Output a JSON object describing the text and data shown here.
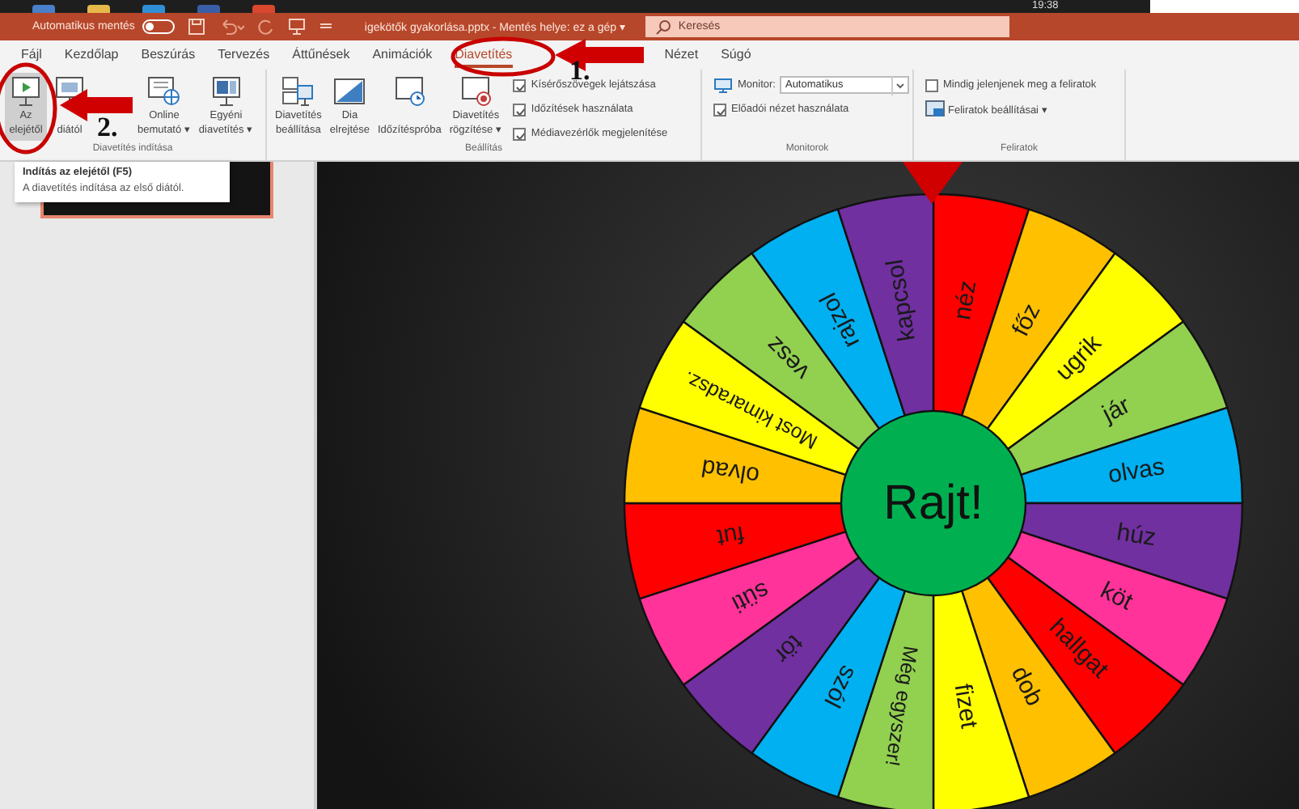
{
  "taskbar": {
    "clock": "19:38"
  },
  "title_bar": {
    "autosave_label": "Automatikus mentés",
    "autosave_on": false,
    "document": "igekötők gyakorlása.pptx  -  Mentés helye: ez a gép ▾",
    "search_placeholder": "Keresés"
  },
  "tabs": [
    {
      "label": "Fájl",
      "selected": false
    },
    {
      "label": "Kezdőlap",
      "selected": false
    },
    {
      "label": "Beszúrás",
      "selected": false
    },
    {
      "label": "Tervezés",
      "selected": false
    },
    {
      "label": "Áttűnések",
      "selected": false
    },
    {
      "label": "Animációk",
      "selected": false
    },
    {
      "label": "Diavetítés",
      "selected": true
    },
    {
      "label": "Nézet",
      "selected": false
    },
    {
      "label": "Súgó",
      "selected": false
    }
  ],
  "ribbon_groups": [
    {
      "title": "Diavetítés indítása",
      "items": [
        {
          "kind": "large",
          "lines": [
            "Az",
            "elejétől"
          ],
          "highlighted": true
        },
        {
          "kind": "large",
          "lines": [
            "diától"
          ],
          "highlighted": false
        },
        {
          "kind": "large",
          "lines": [
            "Online",
            "bemutató ▾"
          ],
          "highlighted": false
        },
        {
          "kind": "large",
          "lines": [
            "Egyéni",
            "diavetítés ▾"
          ],
          "highlighted": false
        }
      ]
    },
    {
      "title": "Beállítás",
      "items": [
        {
          "kind": "large",
          "lines": [
            "Diavetítés",
            "beállítása"
          ],
          "highlighted": false
        },
        {
          "kind": "large",
          "lines": [
            "Dia",
            "elrejtése"
          ],
          "highlighted": false
        },
        {
          "kind": "large",
          "lines": [
            "Időzítéspróba"
          ],
          "highlighted": false
        },
        {
          "kind": "large",
          "lines": [
            "Diavetítés",
            "rögzítése ▾"
          ],
          "highlighted": false
        },
        {
          "kind": "checkbox",
          "label": "Kísérőszövegek lejátszása",
          "checked": true
        },
        {
          "kind": "checkbox",
          "label": "Időzítések használata",
          "checked": true
        },
        {
          "kind": "checkbox",
          "label": "Médiavezérlők megjelenítése",
          "checked": true
        }
      ]
    },
    {
      "title": "Monitorok",
      "items": [
        {
          "kind": "dropdown",
          "label": "Monitor:",
          "value": "Automatikus"
        },
        {
          "kind": "checkbox",
          "label": "Előadói nézet használata",
          "checked": true
        }
      ]
    },
    {
      "title": "Feliratok",
      "items": [
        {
          "kind": "checkbox",
          "label": "Mindig jelenjenek meg a feliratok",
          "checked": false
        },
        {
          "kind": "menu-button",
          "label": "Feliratok beállításai ▾"
        }
      ]
    }
  ],
  "tooltip": {
    "title": "Indítás az elejétől (F5)",
    "text": "A diavetítés indítása az első diától."
  },
  "slide_thumbnails": [
    {
      "selected": true
    }
  ],
  "wheel": {
    "center_label": "Rajt!",
    "segments": [
      {
        "label": "néz",
        "color": "#ff0000"
      },
      {
        "label": "főz",
        "color": "#ffc000"
      },
      {
        "label": "ugrik",
        "color": "#ffff00"
      },
      {
        "label": "jár",
        "color": "#92d050"
      },
      {
        "label": "olvas",
        "color": "#00b0f0"
      },
      {
        "label": "húz",
        "color": "#7030a0"
      },
      {
        "label": "köt",
        "color": "#ff3399"
      },
      {
        "label": "hallgat",
        "color": "#ff0000"
      },
      {
        "label": "dob",
        "color": "#ffc000"
      },
      {
        "label": "fizet",
        "color": "#ffff00"
      },
      {
        "label": "Még egyszer!",
        "color": "#92d050"
      },
      {
        "label": "szól",
        "color": "#00b0f0"
      },
      {
        "label": "tör",
        "color": "#7030a0"
      },
      {
        "label": "süti",
        "color": "#ff3399"
      },
      {
        "label": "fut",
        "color": "#ff0000"
      },
      {
        "label": "olvad",
        "color": "#ffc000"
      },
      {
        "label": "Most kimaradsz.",
        "color": "#ffff00"
      },
      {
        "label": "vesz",
        "color": "#92d050"
      },
      {
        "label": "rajzol",
        "color": "#00b0f0"
      },
      {
        "label": "kapcsol",
        "color": "#7030a0"
      }
    ]
  },
  "annotations": [
    {
      "label": "1."
    },
    {
      "label": "2."
    }
  ]
}
